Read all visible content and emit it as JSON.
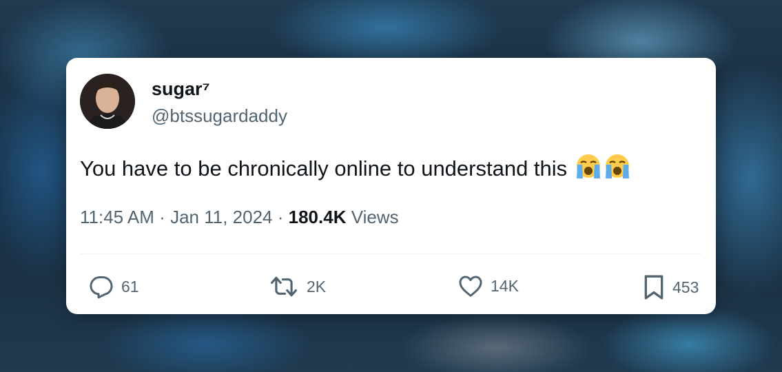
{
  "tweet": {
    "display_name": "sugar⁷",
    "handle": "@btssugardaddy",
    "text": "You have to be chronically online to understand this",
    "emojis": [
      "loudly-crying-face-emoji",
      "loudly-crying-face-emoji"
    ],
    "time": "11:45 AM",
    "separator": "·",
    "date": "Jan 11, 2024",
    "views_count": "180.4K",
    "views_label": "Views"
  },
  "actions": {
    "replies": "61",
    "reposts": "2K",
    "likes": "14K",
    "bookmarks": "453"
  },
  "icons": {
    "reply": "reply-icon",
    "repost": "repost-icon",
    "like": "heart-icon",
    "bookmark": "bookmark-icon"
  },
  "colors": {
    "primary_text": "#0f1419",
    "secondary_text": "#536471",
    "card_background": "#ffffff",
    "divider": "#eff3f4"
  }
}
